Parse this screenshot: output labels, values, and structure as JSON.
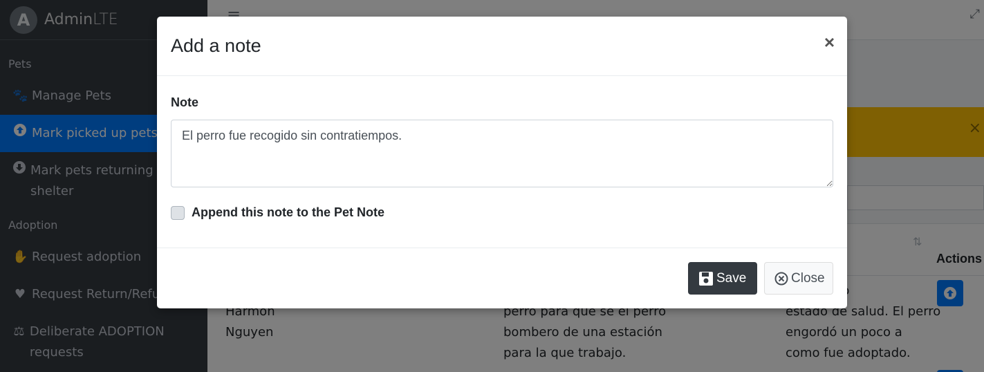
{
  "brand": {
    "logo_letter": "A",
    "name_bold": "Admin",
    "name_light": "LTE"
  },
  "sidebar": {
    "headers": [
      "Pets",
      "Adoption"
    ],
    "items": [
      {
        "label": "Manage Pets",
        "icon": "paw-icon"
      },
      {
        "label": "Mark picked up pets",
        "icon": "arrow-circle-up-icon"
      },
      {
        "label": "Mark pets returning to shelter",
        "icon": "arrow-circle-down-icon"
      },
      {
        "label": "Request adoption",
        "icon": "hand-holding-icon"
      },
      {
        "label": "Request Return/Refun",
        "icon": "heart-icon"
      },
      {
        "label": "Deliberate ADOPTION requests",
        "icon": "balance-scale-icon"
      }
    ]
  },
  "table": {
    "actions_header": "Actions",
    "row1": {
      "col1": "Harmon\nNguyen",
      "col2": "perro para que se el perro\nbombero de una estación\npara la que trabajo.",
      "col3": "n perfecto\nestado de salud. El perro\nengordó un poco a\ncomo fue adoptado."
    }
  },
  "modal": {
    "title": "Add a note",
    "close_symbol": "×",
    "note_label": "Note",
    "note_value": "El perro fue recogido sin contratiempos.",
    "append_label": "Append this note to the Pet Note",
    "append_checked": false,
    "save_label": "Save",
    "close_label": "Close"
  },
  "colors": {
    "sidebar_bg": "#343a40",
    "active_bg": "#007bff",
    "alert_bg": "#ffc107",
    "save_btn_bg": "#343a40"
  }
}
